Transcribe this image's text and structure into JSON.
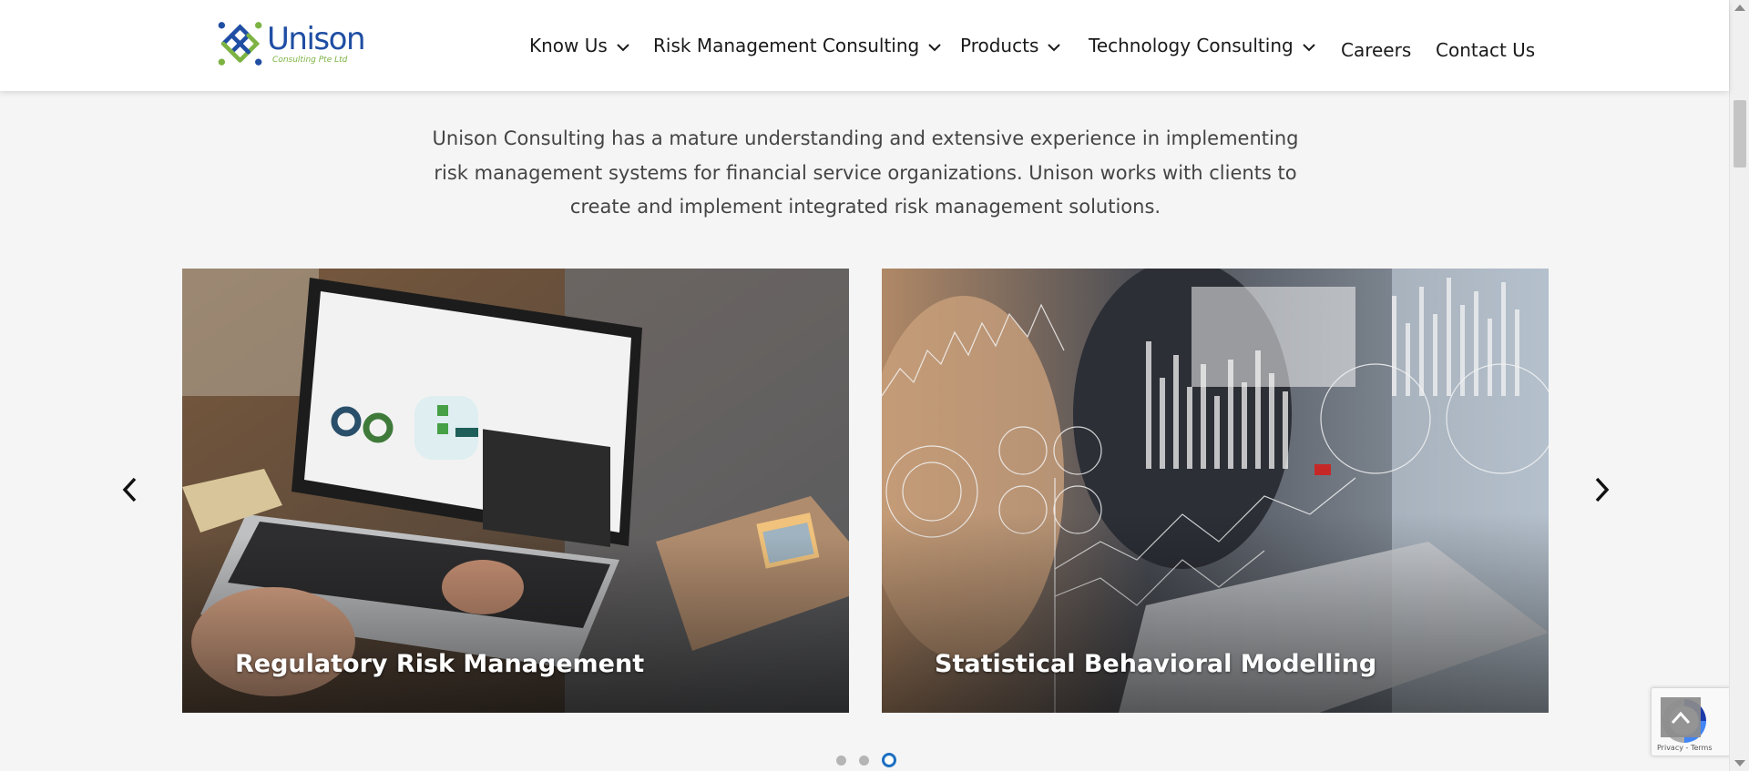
{
  "brand": {
    "name": "Unison",
    "tagline": "Consulting Pte Ltd",
    "color_blue": "#1f4ea3",
    "color_green": "#7cb342"
  },
  "nav": {
    "items": [
      {
        "label": "Know Us",
        "dropdown": true
      },
      {
        "label": "Risk Management Consulting",
        "dropdown": true
      },
      {
        "label": "Products",
        "dropdown": true
      },
      {
        "label": "Technology Consulting",
        "dropdown": true
      },
      {
        "label": "Careers",
        "dropdown": false
      },
      {
        "label": "Contact Us",
        "dropdown": false
      }
    ]
  },
  "intro": {
    "text": "Unison Consulting has a mature understanding and extensive experience in implementing risk management systems for financial service organizations. Unison works with clients to create and implement integrated risk management solutions."
  },
  "carousel": {
    "slides": [
      {
        "caption": "Regulatory Risk Management"
      },
      {
        "caption": "Statistical Behavioral Modelling"
      }
    ],
    "active_dot": 3,
    "dot_count": 3,
    "accent": "#1d6fc2"
  },
  "recaptcha": {
    "terms": "Privacy - Terms"
  }
}
